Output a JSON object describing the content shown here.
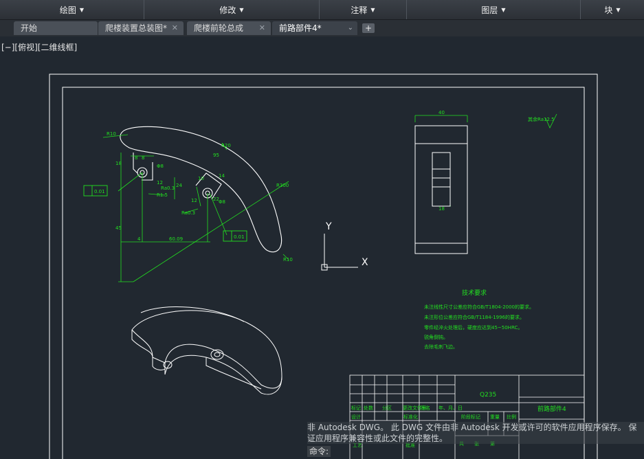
{
  "ribbon": {
    "panels": [
      {
        "label": "绘图",
        "width": 210
      },
      {
        "label": "修改",
        "width": 255
      },
      {
        "label": "注释",
        "width": 127
      },
      {
        "label": "图层",
        "width": 253
      },
      {
        "label": "块",
        "width": 92
      }
    ]
  },
  "tabs": [
    {
      "label": "开始",
      "close": ""
    },
    {
      "label": "爬楼装置总装图*",
      "close": "✕"
    },
    {
      "label": "爬楼前轮总成",
      "close": "✕"
    },
    {
      "label": "前路部件4*",
      "close": "⌄"
    }
  ],
  "viewport_label": "[−][俯视][二维线框]",
  "drawing": {
    "dims": {
      "r10_top": "R10",
      "r20": "R20",
      "r300": "R300",
      "r10_bottom": "R10",
      "d45": "45",
      "d40_top": "40",
      "d18": "18",
      "d18b": "18",
      "d14": "14",
      "d12": "12",
      "d10": "10",
      "d12b": "12",
      "d8": "8",
      "d24": "24",
      "d22": "22",
      "d8b": "8",
      "d4": "4",
      "d95": "95",
      "r1_5": "R1.5",
      "d60": "60.09",
      "tol_1": "0.01",
      "tol_2": "0.01",
      "phi_1": "Φ8",
      "phi_2": "Φ8",
      "ra_1": "Ra0.3",
      "ra_2": "Ra0.3",
      "roughness_note": "其余Ra12.5"
    },
    "ucs": {
      "x": "X",
      "y": "Y"
    },
    "tech": {
      "title": "技术要求",
      "lines": [
        "未注线性尺寸公差应符合GB/T1804-2000的要求。",
        "未注形位公差应符合GB/T1184-1996的要求。",
        "零件经淬火处理后，硬度应达到45~50HRC。",
        "锐角倒钝。",
        "去除毛刺飞边。"
      ]
    },
    "title_block": {
      "material": "Q235",
      "part_name": "前路部件4",
      "h_mark": "标记",
      "h_count": "处数",
      "h_zone": "分区",
      "h_change": "更改文件号",
      "h_sign": "签名",
      "h_date": "年、月、日",
      "r_design": "设计",
      "r_std": "标准化",
      "r_stage": "阶段标记",
      "r_weight": "重量",
      "r_scale": "比例",
      "r_proc": "工艺",
      "r_approve": "批准",
      "r_total": "共",
      "r_sheet": "张",
      "r_no": "第"
    }
  },
  "command": {
    "message": "非 Autodesk DWG。  此 DWG 文件由非 Autodesk 开发或许可的软件应用程序保存。  保证应用程序兼容性或此文件的完整性。",
    "prompt": "命令:"
  },
  "colors": {
    "background": "#212830",
    "drawing_line": "#ffffff",
    "dimension": "#22e020"
  }
}
